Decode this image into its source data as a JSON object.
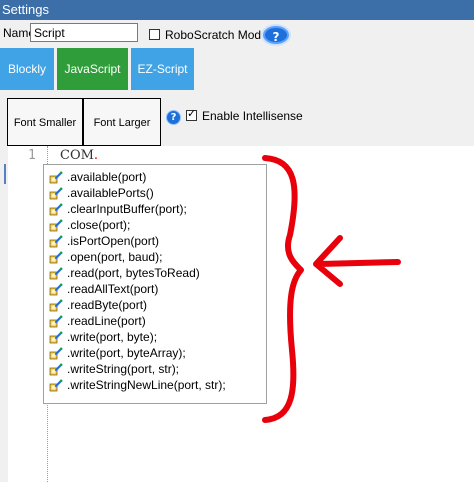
{
  "window": {
    "title": "Settings"
  },
  "name_field": {
    "label": "Name",
    "value": "Script"
  },
  "roboscratch": {
    "label": "RoboScratch Module",
    "checked": false
  },
  "help_glyph": "?",
  "modes": {
    "blockly": "Blockly",
    "javascript": "JavaScript",
    "ezscript": "EZ-Script"
  },
  "font_buttons": {
    "smaller": "Font Smaller",
    "larger": "Font Larger"
  },
  "intellisense": {
    "label": "Enable Intellisense",
    "checked": true
  },
  "editor": {
    "line_number": "1",
    "code": "COM",
    "dot": "."
  },
  "suggestions": [
    ".available(port)",
    ".availablePorts()",
    ".clearInputBuffer(port);",
    ".close(port);",
    ".isPortOpen(port)",
    ".open(port, baud);",
    ".read(port, bytesToRead)",
    ".readAllText(port)",
    ".readByte(port)",
    ".readLine(port)",
    ".write(port, byte);",
    ".write(port, byteArray);",
    ".writeString(port, str);",
    ".writeStringNewLine(port, str);"
  ],
  "colors": {
    "titlebar": "#3c6ea8",
    "tab_blue": "#3fa3e6",
    "tab_active": "#2f9e3a",
    "annotation": "#e8000b"
  },
  "icons": {
    "suggestion": "method-icon",
    "help": "help-icon"
  }
}
